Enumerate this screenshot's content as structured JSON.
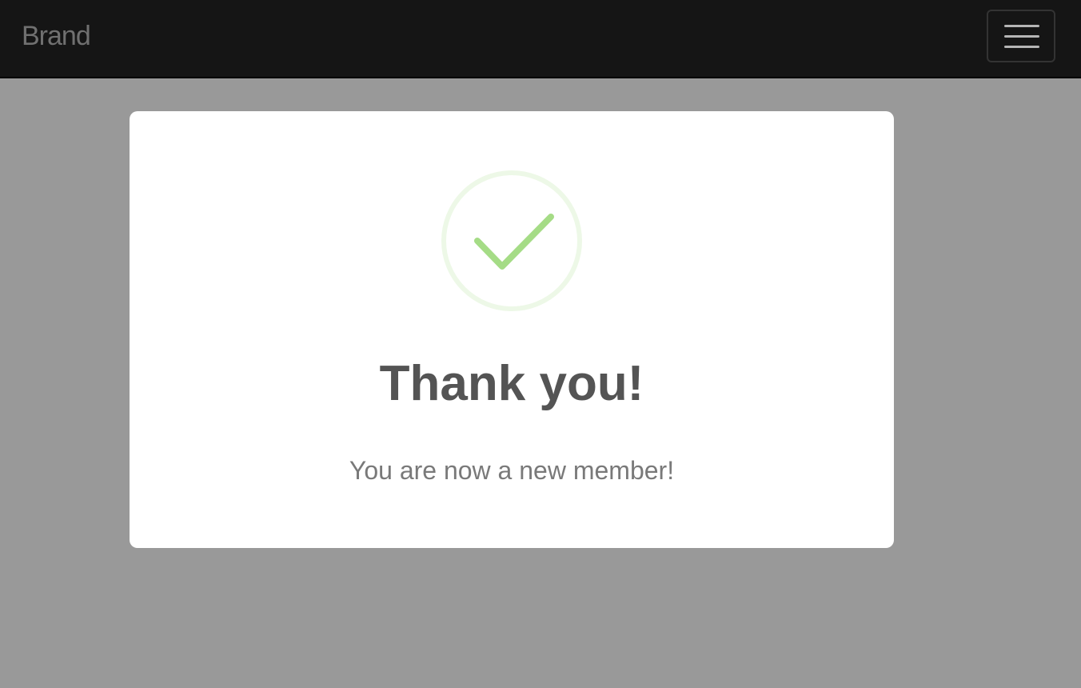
{
  "navbar": {
    "brand": "Brand",
    "menu_icon": "hamburger-menu-icon"
  },
  "modal": {
    "icon": "success-checkmark-icon",
    "title": "Thank you!",
    "message": "You are now a new member!"
  },
  "colors": {
    "navbar_bg": "#151515",
    "overlay_bg": "#999999",
    "modal_bg": "#ffffff",
    "success": "#a5dc86",
    "title": "#545454",
    "message": "#797979"
  }
}
